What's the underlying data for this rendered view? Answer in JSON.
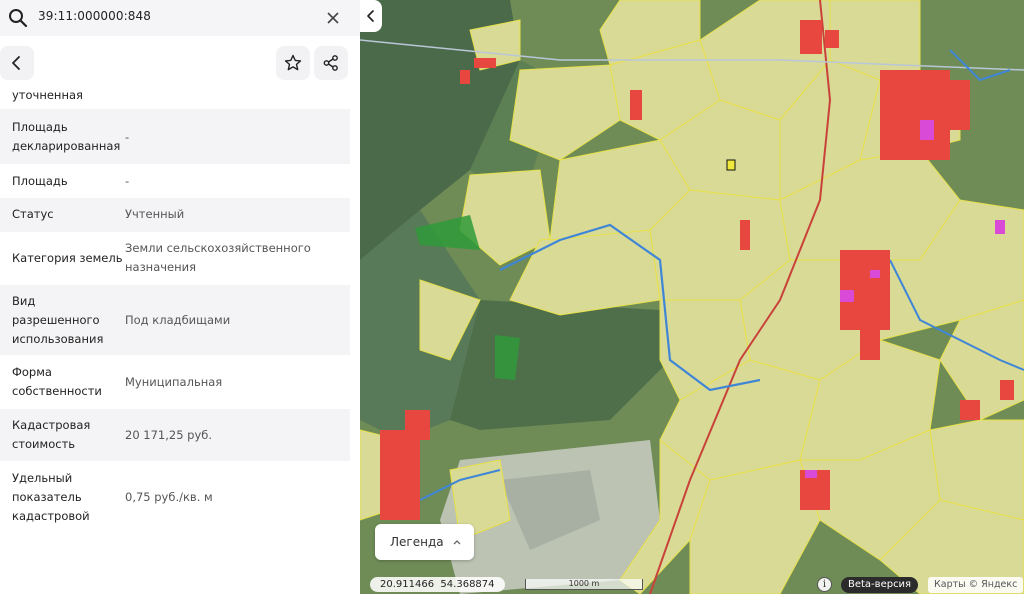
{
  "search": {
    "value": "39:11:000000:848",
    "icon": "search-icon",
    "clear_icon": "close-icon"
  },
  "toolbar": {
    "back_icon": "chevron-left-icon",
    "favorite_icon": "star-icon",
    "share_icon": "share-icon"
  },
  "attributes": [
    {
      "key": "уточненная",
      "value": ""
    },
    {
      "key": "Площадь декларированная",
      "value": "-"
    },
    {
      "key": "Площадь",
      "value": "-"
    },
    {
      "key": "Статус",
      "value": "Учтенный"
    },
    {
      "key": "Категория земель",
      "value": "Земли сельскохозяйственного назначения"
    },
    {
      "key": "Вид разрешенного использования",
      "value": "Под кладбищами"
    },
    {
      "key": "Форма собственности",
      "value": "Муниципальная"
    },
    {
      "key": "Кадастровая стоимость",
      "value": "20 171,25 руб."
    },
    {
      "key": "Удельный показатель кадастровой",
      "value": "0,75 руб./кв. м"
    }
  ],
  "map": {
    "collapse_icon": "chevron-left-icon",
    "legend_label": "Легенда",
    "legend_icon": "chevron-up-icon",
    "coordinates": "20.911466  54.368874",
    "scale_label": "1000 m",
    "info_icon": "info-icon",
    "beta_label": "Beta-версия",
    "attribution": "Карты © Яндекс",
    "colors": {
      "parcel_outline": "#e8e04a",
      "parcel_fill": "#e9e79a",
      "building": "#e8473f",
      "highlight": "#d94ad6",
      "water": "#3f86d6",
      "road": "#c9423a",
      "forest": "#3d5a3a"
    }
  }
}
